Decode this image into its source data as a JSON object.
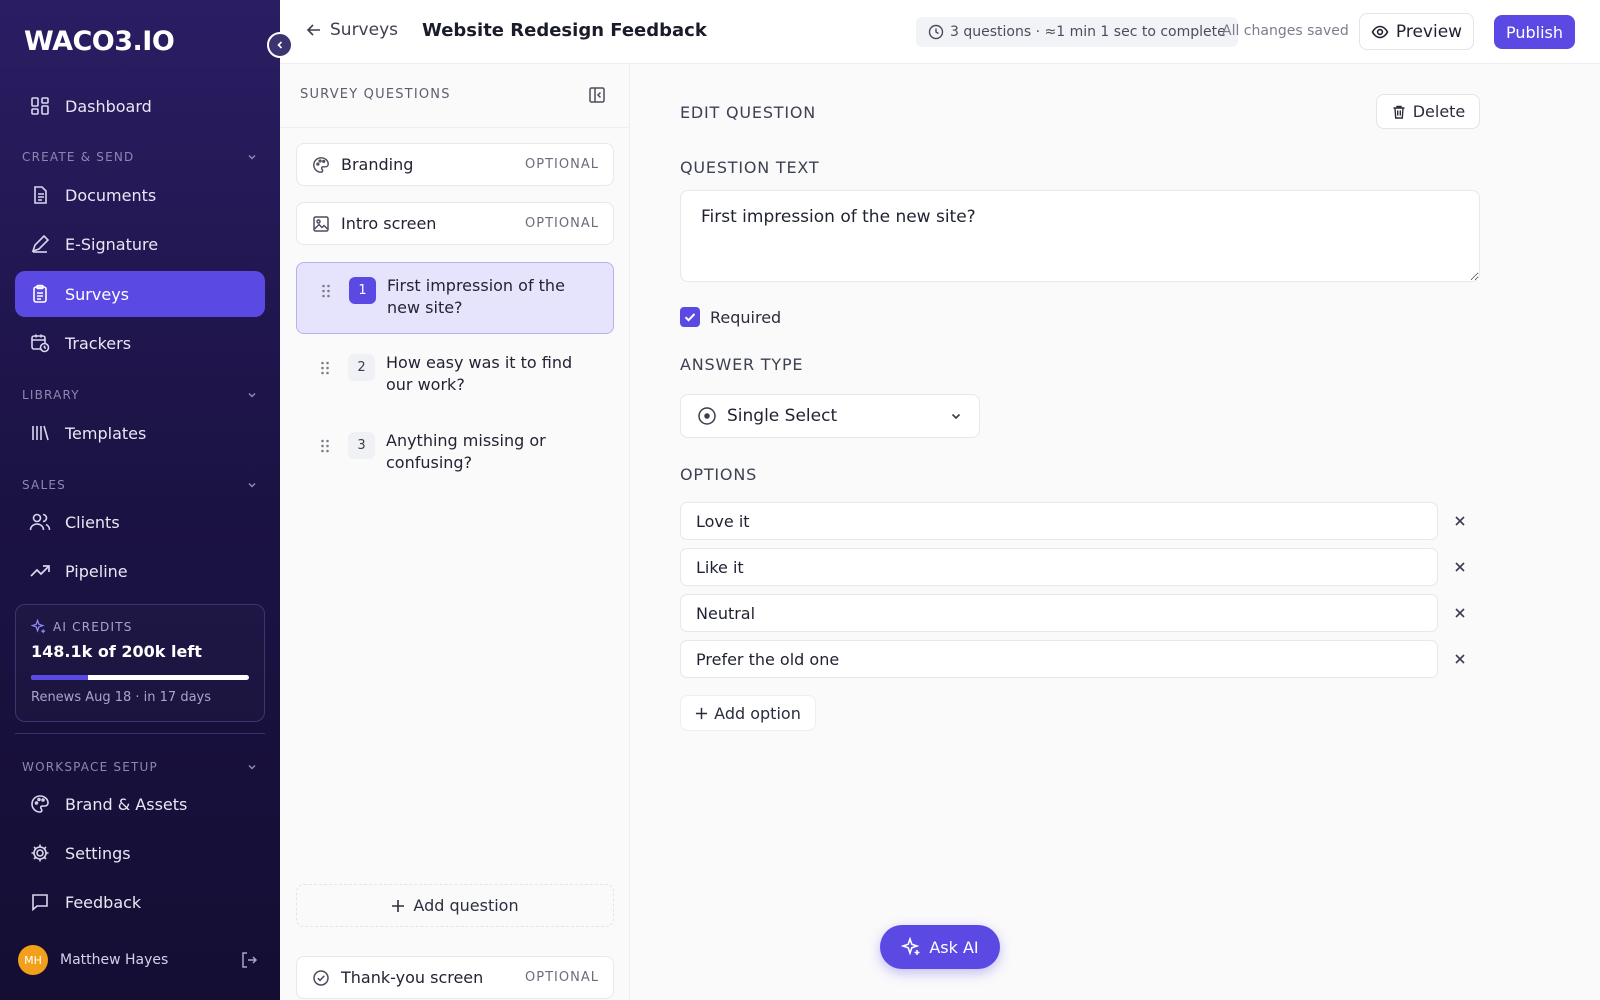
{
  "sidebar": {
    "logo": "WACO3.IO",
    "nav": {
      "dashboard": "Dashboard",
      "documents": "Documents",
      "esignature": "E-Signature",
      "surveys": "Surveys",
      "trackers": "Trackers",
      "templates": "Templates",
      "clients": "Clients",
      "pipeline": "Pipeline",
      "brand": "Brand & Assets",
      "settings": "Settings",
      "feedback": "Feedback"
    },
    "sections": {
      "create": "CREATE & SEND",
      "library": "LIBRARY",
      "sales": "SALES",
      "workspace": "WORKSPACE SETUP"
    },
    "credits": {
      "label": "AI CREDITS",
      "value": "148.1k of 200k left",
      "renews": "Renews Aug 18 · in 17 days",
      "used_fraction": 0.26
    },
    "user": {
      "initials": "MH",
      "name": "Matthew Hayes"
    }
  },
  "header": {
    "back_label": "Surveys",
    "title": "Website Redesign Feedback",
    "meta": "3 questions · ≈1 min 1 sec to complete",
    "saved": "All changes saved",
    "preview": "Preview",
    "publish": "Publish"
  },
  "panel": {
    "title": "SURVEY QUESTIONS",
    "optional": "OPTIONAL",
    "branding": "Branding",
    "intro": "Intro screen",
    "questions": [
      {
        "num": "1",
        "text": "First impression of the new site?"
      },
      {
        "num": "2",
        "text": "How easy was it to find our work?"
      },
      {
        "num": "3",
        "text": "Anything missing or confusing?"
      }
    ],
    "add_question": "Add question",
    "thankyou": "Thank-you screen"
  },
  "editor": {
    "title": "EDIT QUESTION",
    "delete": "Delete",
    "question_text_label": "QUESTION TEXT",
    "question_text": "First impression of the new site?",
    "required": "Required",
    "answer_type_label": "ANSWER TYPE",
    "answer_type": "Single Select",
    "options_label": "OPTIONS",
    "options": [
      "Love it",
      "Like it",
      "Neutral",
      "Prefer the old one"
    ],
    "add_option": "Add option",
    "ask_ai": "Ask AI"
  },
  "colors": {
    "accent": "#5a4ae3",
    "sidebar": "#1c1346",
    "avatar": "#f2a01a"
  }
}
